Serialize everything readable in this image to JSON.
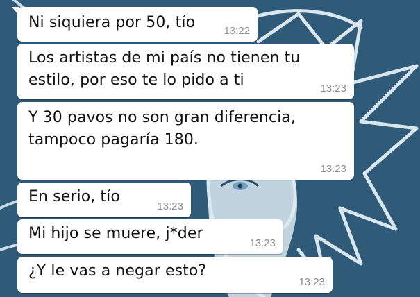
{
  "messages": [
    {
      "text": "Ni siquiera por 50, tío",
      "time": "13:22"
    },
    {
      "text": "Los artistas de mi país no tienen tu\nestilo, por eso te lo pido a ti",
      "time": "13:23"
    },
    {
      "text": "Y 30 pavos no son gran diferencia,\ntampoco pagaría 180.",
      "time": "13:23"
    },
    {
      "text": "En serio, tío",
      "time": "13:23"
    },
    {
      "text": "Mi hijo se muere, j*der",
      "time": "13:23"
    },
    {
      "text": "¿Y le vas a negar esto?",
      "time": "13:23"
    }
  ],
  "colors": {
    "wallpaper": "#2f5a78",
    "bubble": "#ffffff",
    "timestamp": "#8e8e8e"
  },
  "icons": [
    "anime-character-wallpaper"
  ]
}
